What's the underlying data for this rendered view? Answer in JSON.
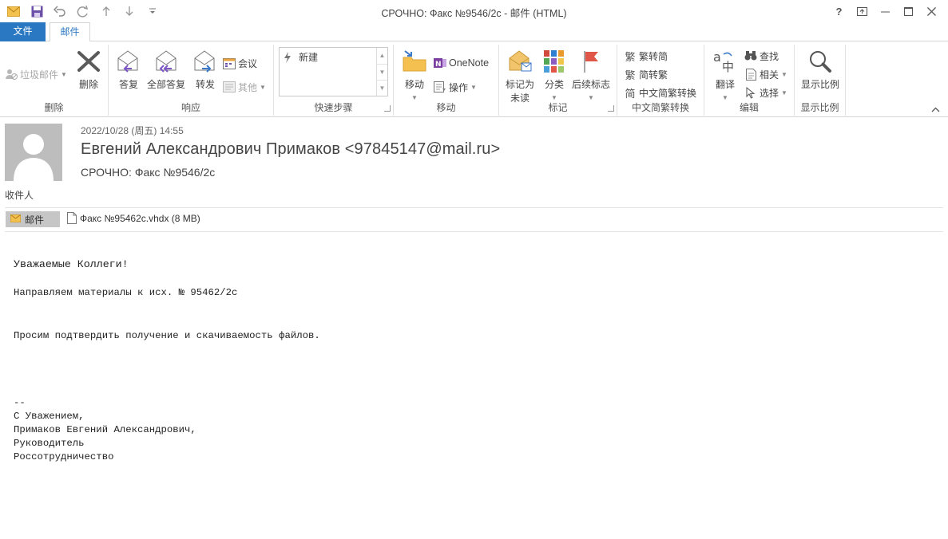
{
  "window": {
    "title": "СРОЧНО: Факс №9546/2с - 邮件 (HTML)",
    "help": "?"
  },
  "tabs": {
    "file": "文件",
    "mail": "邮件"
  },
  "ribbon": {
    "delete_group": {
      "junk": "垃圾邮件",
      "delete": "删除",
      "label": "删除"
    },
    "respond_group": {
      "reply": "答复",
      "reply_all": "全部答复",
      "forward": "转发",
      "meeting": "会议",
      "more": "其他",
      "label": "响应"
    },
    "quicksteps_group": {
      "new": "新建",
      "label": "快速步骤"
    },
    "move_group": {
      "move": "移动",
      "onenote": "OneNote",
      "actions": "操作",
      "label": "移动"
    },
    "tags_group": {
      "mark_unread_line1": "标记为",
      "mark_unread_line2": "未读",
      "categorize": "分类",
      "follow_up": "后续标志",
      "label": "标记"
    },
    "chinese_group": {
      "to_simplified": "繁转简",
      "to_traditional": "简转繁",
      "convert": "中文简繁转换",
      "label": "中文简繁转换"
    },
    "editing_group": {
      "translate": "翻译",
      "find": "查找",
      "related": "相关",
      "select": "选择",
      "label": "编辑"
    },
    "zoom_group": {
      "zoom": "显示比例",
      "label": "显示比例"
    }
  },
  "message": {
    "date": "2022/10/28 (周五) 14:55",
    "sender": "Евгений Александрович  Примаков <97845147@mail.ru>",
    "subject": "СРОЧНО: Факс №9546/2с",
    "recipients_label": "收件人",
    "message_button": "邮件",
    "attachment": "Факс №95462с.vhdx (8 MB)"
  },
  "body": {
    "line1": "Уважаемые Коллеги!",
    "line2": "Направляем материалы к исх. № 95462/2с",
    "line3": "Просим подтвердить получение и скачиваемость файлов.",
    "line4": "--",
    "line5": "С Уважением,",
    "line6": "Примаков Евгений Александрович,",
    "line7": "Руководитель",
    "line8": "Россотрудничество"
  },
  "colors": {
    "accent": "#2b78c2",
    "purple": "#6b4fa8",
    "flag": "#e0574a"
  }
}
